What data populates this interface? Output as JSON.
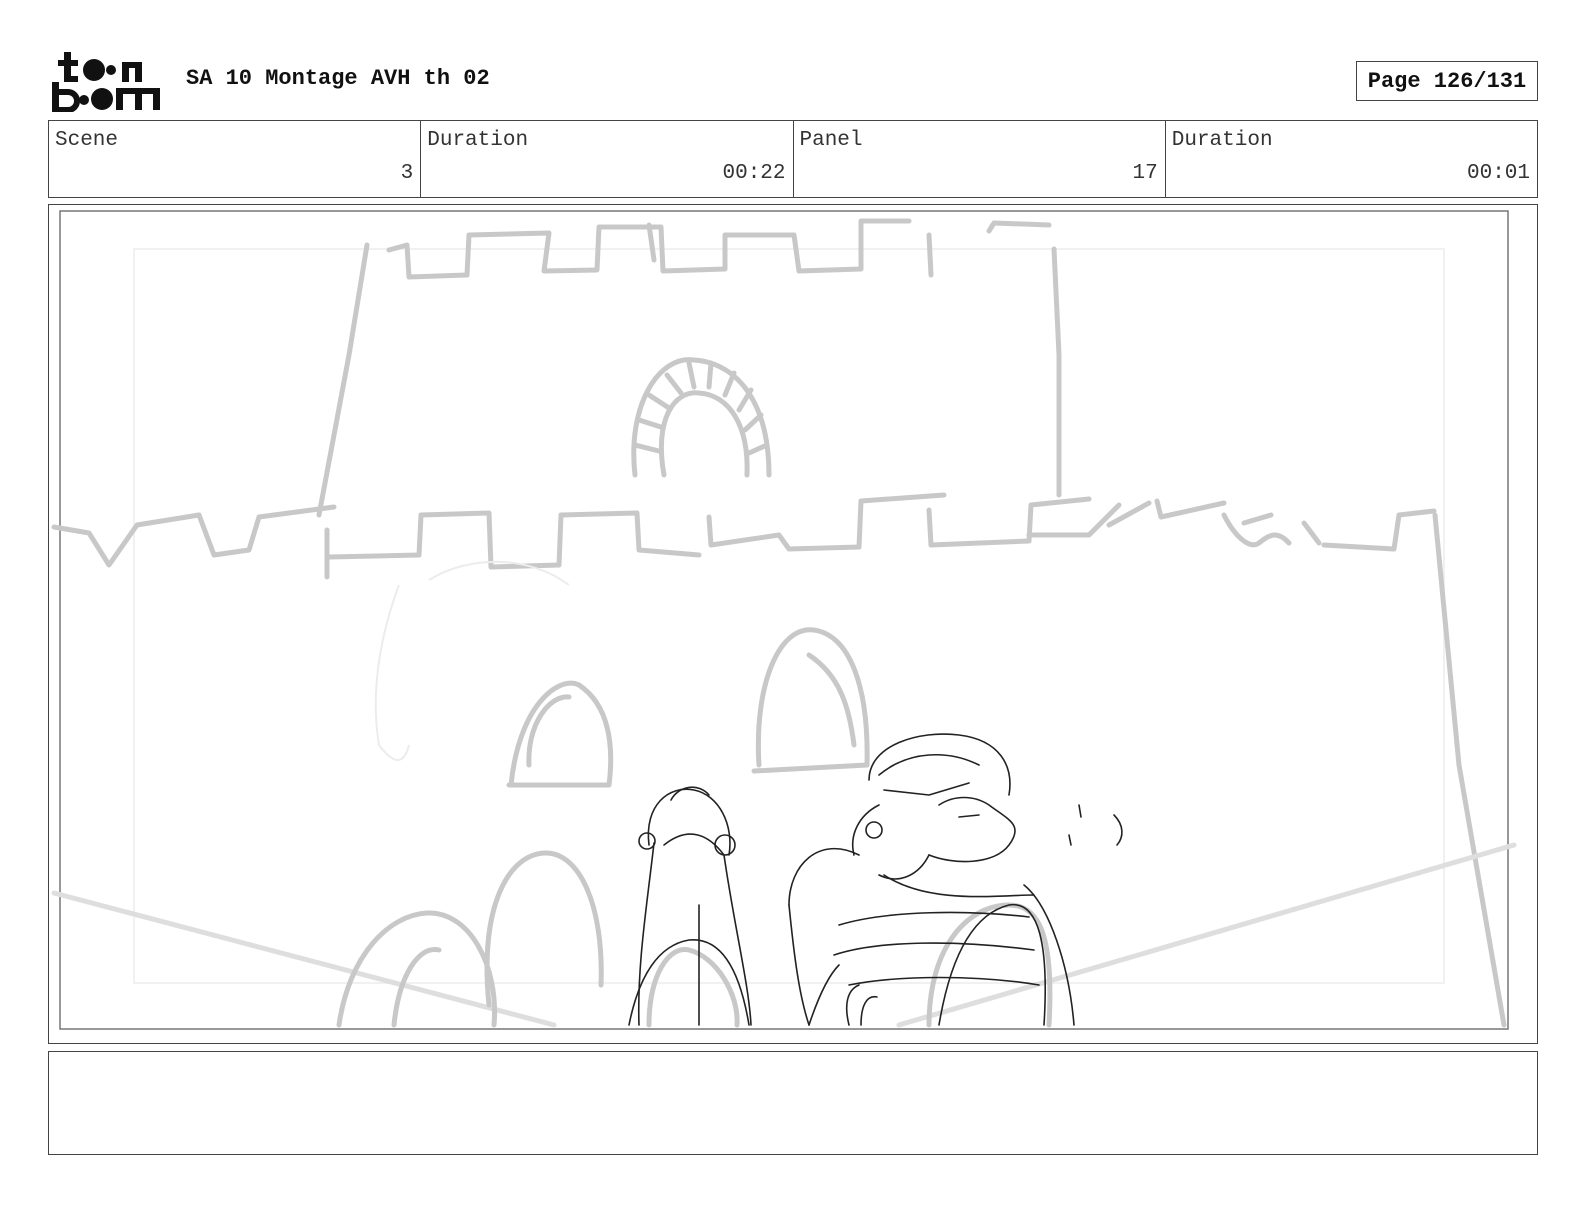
{
  "header": {
    "logo_text": "toon boom",
    "title": "SA 10 Montage AVH th 02",
    "page_label": "Page 126/131"
  },
  "info": [
    {
      "label": "Scene",
      "value": "3"
    },
    {
      "label": "Duration",
      "value": "00:22"
    },
    {
      "label": "Panel",
      "value": "17"
    },
    {
      "label": "Duration",
      "value": "00:01"
    }
  ],
  "panel": {
    "icon": "castle-sketch-with-gorilla-characters"
  },
  "notes": {
    "text": ""
  },
  "colors": {
    "border": "#444444",
    "sketch_gray": "#c8c8c8",
    "sketch_dark": "#222222"
  }
}
